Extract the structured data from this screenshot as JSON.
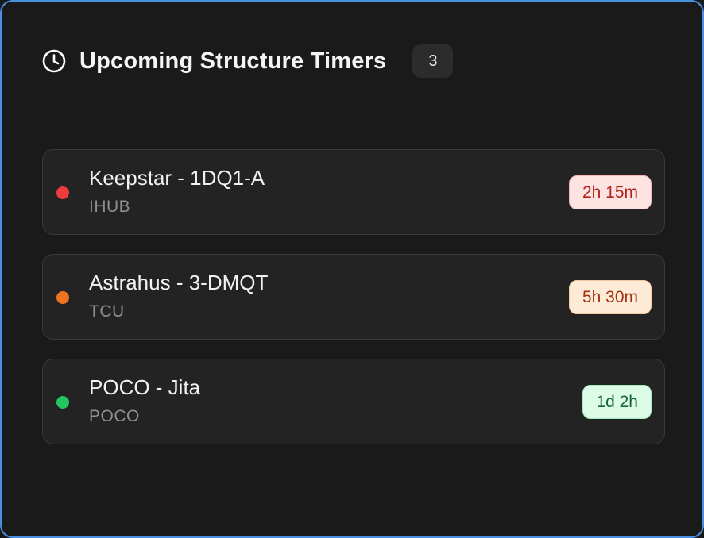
{
  "header": {
    "title": "Upcoming Structure Timers",
    "count": "3",
    "icon": "clock-icon"
  },
  "colors": {
    "panel_border": "#4a90e2",
    "background": "#1a1a1a"
  },
  "timers": [
    {
      "name": "Keepstar - 1DQ1-A",
      "type": "IHUB",
      "remaining": "2h 15m",
      "status": "critical",
      "dot_color": "#ef3b3b",
      "badge_bg": "#fde2e2",
      "badge_border": "#f5b5b5",
      "badge_text": "#b42318"
    },
    {
      "name": "Astrahus - 3-DMQT",
      "type": "TCU",
      "remaining": "5h 30m",
      "status": "warning",
      "dot_color": "#f07322",
      "badge_bg": "#fdebd7",
      "badge_border": "#f6c99c",
      "badge_text": "#a4320f"
    },
    {
      "name": "POCO - Jita",
      "type": "POCO",
      "remaining": "1d 2h",
      "status": "ok",
      "dot_color": "#22c55e",
      "badge_bg": "#dcfce7",
      "badge_border": "#a7e8bd",
      "badge_text": "#166534"
    }
  ]
}
